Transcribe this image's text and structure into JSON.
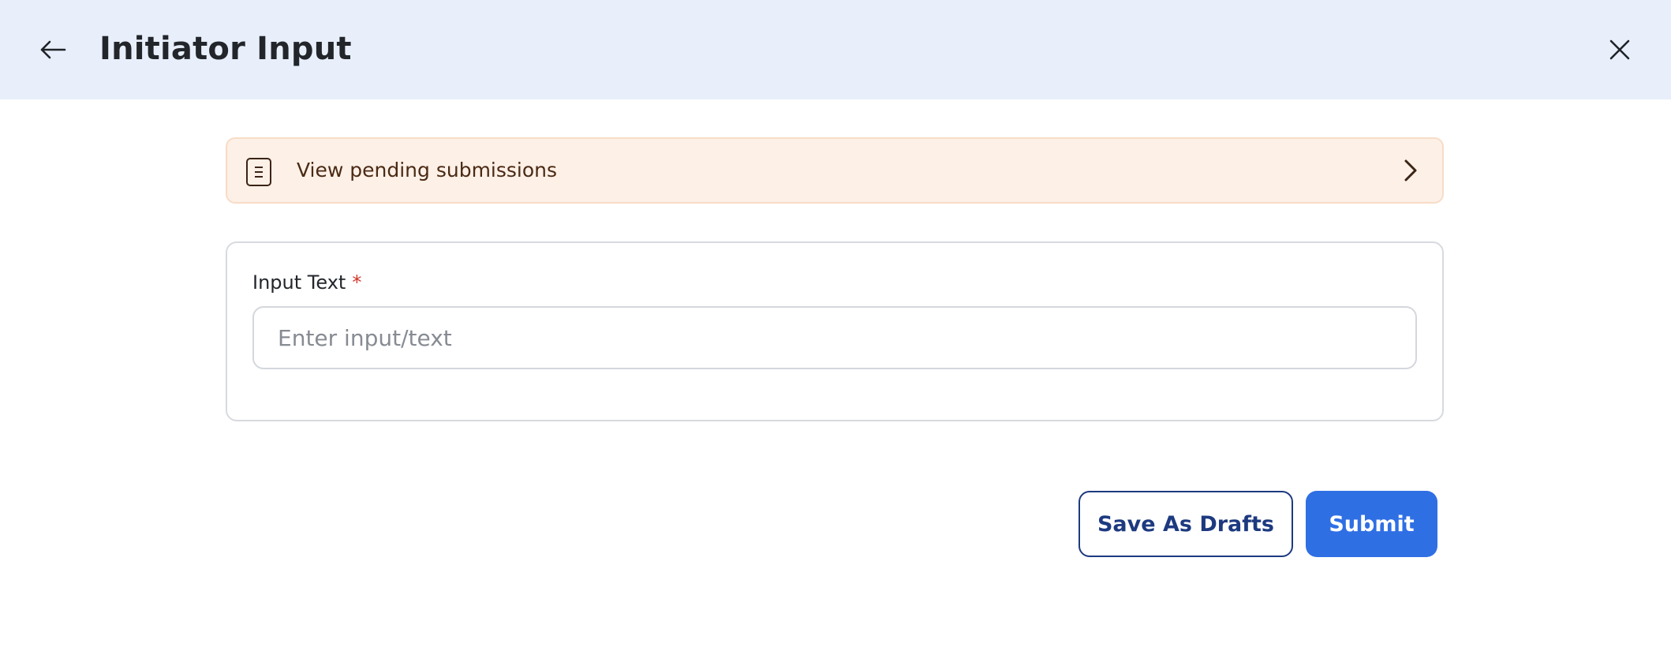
{
  "header": {
    "title": "Initiator Input",
    "back_icon": "arrow-left-icon",
    "close_icon": "close-icon",
    "background_color": "#e8effb"
  },
  "pending_banner": {
    "label": "View pending submissions",
    "icon": "document-icon",
    "chevron_icon": "chevron-right-icon",
    "background_color": "#fdf0e7"
  },
  "form": {
    "field_label": "Input Text",
    "required_marker": "*",
    "input_value": "",
    "input_placeholder": "Enter input/text"
  },
  "actions": {
    "save_drafts_label": "Save As Drafts",
    "submit_label": "Submit",
    "accent_color": "#2f6fe4",
    "secondary_color": "#1d3a80"
  }
}
